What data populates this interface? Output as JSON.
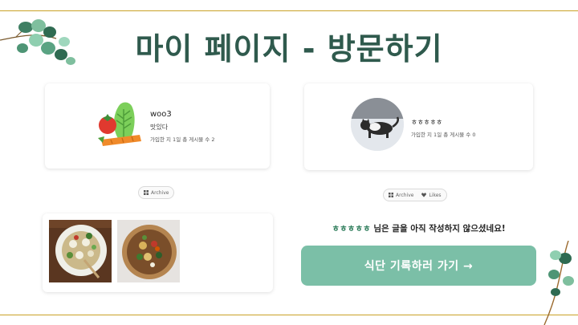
{
  "page": {
    "title": "마이 페이지 - 방문하기"
  },
  "my_profile": {
    "username": "woo3",
    "bio": "맛있다",
    "stats": "가입한 지 1일 총 게시물 수 2",
    "avatar_icon": "vegetables-icon"
  },
  "visit_profile": {
    "username": "ㅎㅎㅎㅎㅎ",
    "stats": "가입한 지 1일 총 게시물 수 0",
    "avatar_icon": "cat-on-snow-photo"
  },
  "my_tabs": {
    "archive_label": "Archive"
  },
  "visit_tabs": {
    "archive_label": "Archive",
    "likes_label": "Likes"
  },
  "posts": [
    {
      "image": "salad-plate-photo"
    },
    {
      "image": "salad-bowl-photo"
    }
  ],
  "empty_state": {
    "nickname": "ㅎㅎㅎㅎㅎ",
    "message": " 님은 글을 아직 작성하지 않으셨네요!"
  },
  "cta": {
    "label": "식단 기록하러 가기 →"
  },
  "colors": {
    "title": "#2f5a4d",
    "accent": "#7bbfa7",
    "rule": "#c9a227",
    "nickname": "#2e7d5b"
  }
}
